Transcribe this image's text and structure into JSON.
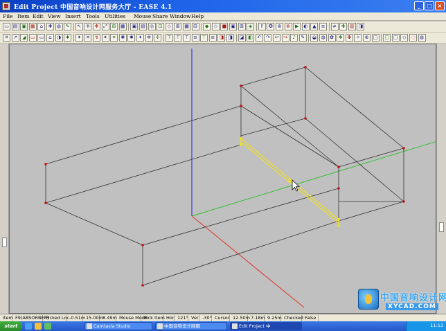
{
  "window": {
    "title": "Edit Project  中国音响设计网服务大厅 - EASE 4.1",
    "controls": {
      "minimize": "_",
      "maximize": "□",
      "close": "×"
    }
  },
  "menubar": {
    "items": [
      "File",
      "Item",
      "Edit",
      "View",
      "Insert",
      "Tools",
      "Utilities",
      "Mouse",
      "Share",
      "Window",
      "Help"
    ]
  },
  "toolbar1": {
    "buttons": [
      "▭",
      "▤",
      "▣",
      "▦",
      "⌂",
      "✚",
      "◍",
      "✎",
      "↖",
      "✛",
      "✥",
      "⤢",
      "⊞",
      "▦",
      "▣",
      "▤",
      "◎",
      "⊡",
      "◇",
      "⊞",
      "▦",
      "⊟",
      "◆",
      "◇",
      "■",
      "▣",
      "⊞",
      "◈",
      "⇑",
      "✪",
      "⊛",
      "⊕",
      "▶",
      "◐",
      "▲",
      "≡",
      "≠",
      "✚",
      "▥",
      "◨"
    ]
  },
  "toolbar2": {
    "buttons": [
      "✕",
      "↗",
      "◢",
      "▭",
      "▭",
      "⌂",
      "◑",
      "♦",
      "✦",
      "✕",
      "↯",
      "✦",
      "✶",
      "✺",
      "✹",
      "✦",
      "✲",
      "✢",
      "⊤",
      "⊤",
      "⊤",
      "≡",
      "⊤",
      "≡",
      "◨",
      "◨",
      "◪",
      "◧",
      "↶",
      "↷",
      "↩",
      "↪",
      "♪",
      "✎",
      "◒",
      "◍",
      "✿",
      "❖",
      "✤",
      "✧",
      "⊕",
      "□",
      "□",
      "□",
      "◇",
      "◌",
      "◍"
    ]
  },
  "status": {
    "fields": [
      "Item",
      "F9(ABSORBER)",
      "Picked Loc",
      "-0.51m",
      "15.00m",
      "8.49m",
      "Mouse Mode",
      "Pick Item",
      "Hor",
      "121°",
      "Ver",
      "-30°",
      "Cursor",
      "12.50m",
      "7.18m",
      "9.25m",
      "Checked",
      "False"
    ]
  },
  "taskbar": {
    "start": "start",
    "tasks": [
      "Camtasia Studio",
      "中国音响设计网服",
      "Edit Project 中"
    ],
    "clock": "11:13"
  },
  "watermark": {
    "title": "中国音响设计网",
    "url": "XYCAD.COM"
  },
  "colors": {
    "axis_x": "#e03020",
    "axis_y": "#30c030",
    "axis_z": "#2020e0",
    "edges": "#303030",
    "vertices": "#c01010",
    "selection": "#f0e020"
  },
  "icons": {
    "cursor": "mouse-pointer-icon"
  }
}
